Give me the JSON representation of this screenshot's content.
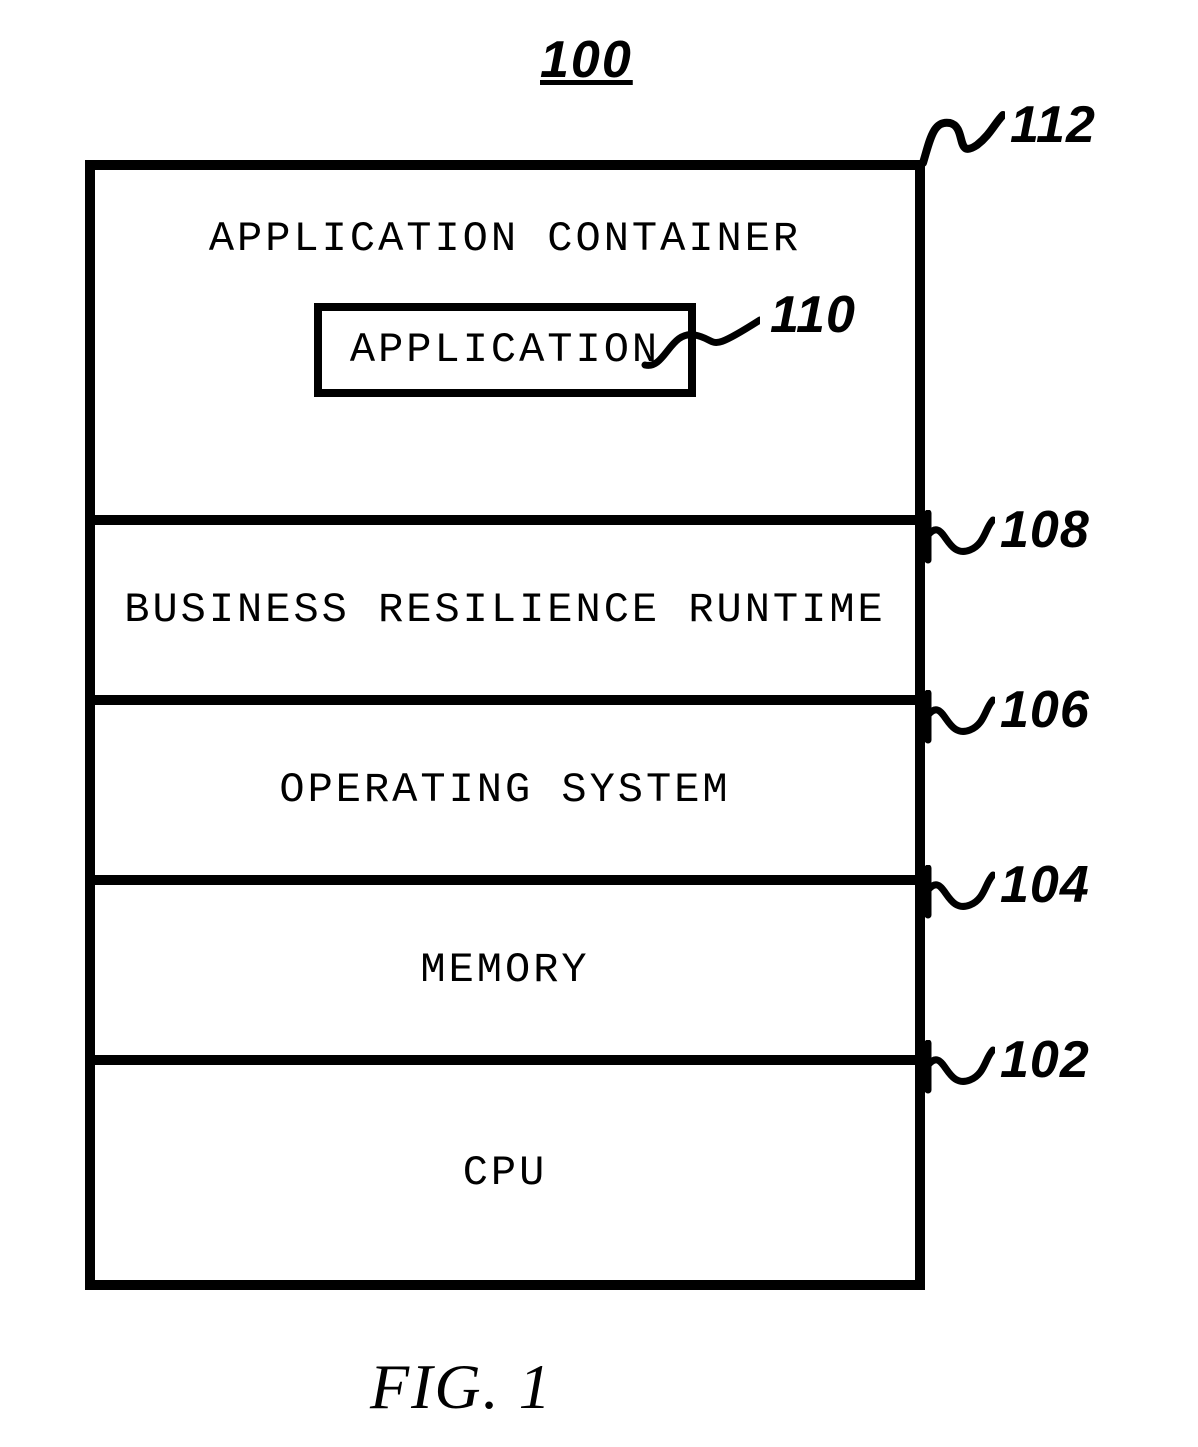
{
  "title_ref": "100",
  "stack": {
    "app_container": "APPLICATION CONTAINER",
    "app_inner": "APPLICATION",
    "brr": "BUSINESS RESILIENCE RUNTIME",
    "os": "OPERATING SYSTEM",
    "mem": "MEMORY",
    "cpu": "CPU"
  },
  "refs": {
    "r112": "112",
    "r110": "110",
    "r108": "108",
    "r106": "106",
    "r104": "104",
    "r102": "102"
  },
  "figure_caption": "FIG. 1"
}
